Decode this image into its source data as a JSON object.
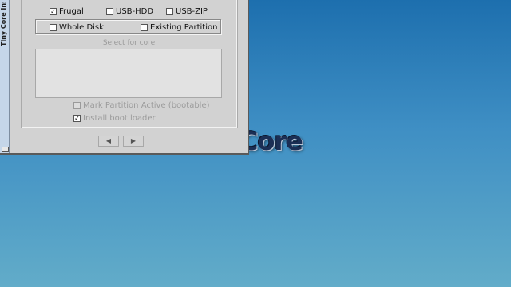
{
  "desktop": {
    "logo_text": "Core"
  },
  "window": {
    "title": "Tiny Core Insta",
    "install_type": [
      {
        "label": "Frugal",
        "checked": true
      },
      {
        "label": "USB-HDD",
        "checked": false
      },
      {
        "label": "USB-ZIP",
        "checked": false
      }
    ],
    "target": [
      {
        "label": "Whole Disk",
        "checked": false
      },
      {
        "label": "Existing Partition",
        "checked": false
      }
    ],
    "select_label": "Select  for core",
    "mark_active": {
      "label": "Mark Partition Active (bootable)",
      "checked": false,
      "enabled": false
    },
    "boot_loader": {
      "label": "Install boot loader",
      "checked": true,
      "enabled": false
    },
    "nav": {
      "back_icon": "◀",
      "next_icon": "▶"
    },
    "check_glyph": "✓"
  }
}
